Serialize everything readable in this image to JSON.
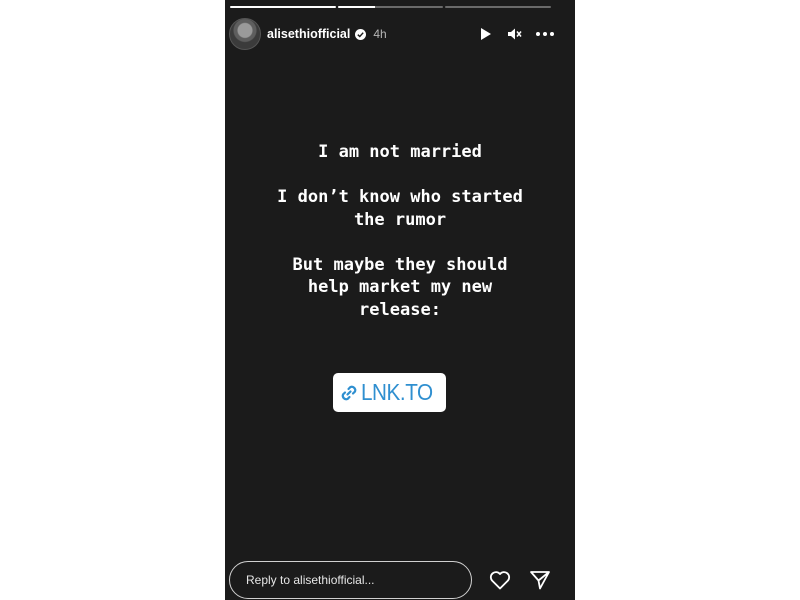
{
  "story": {
    "progress_segments": [
      1,
      0.35,
      0
    ],
    "header": {
      "username": "alisethiofficial",
      "verified": true,
      "time": "4h",
      "avatar_icon": "profile-photo",
      "controls": [
        "play-icon",
        "mute-icon",
        "more-options-icon"
      ]
    },
    "text_lines": [
      "I am not married",
      "I don’t know who started\nthe rumor",
      "But maybe they should\nhelp market my new\nrelease:"
    ],
    "link_sticker": {
      "label": "LNK.TO",
      "icon": "link-icon",
      "color": "#2f8fd0"
    },
    "reply": {
      "placeholder": "Reply to alisethiofficial...",
      "value": ""
    },
    "footer_icons": [
      "heart-icon",
      "send-icon"
    ]
  }
}
